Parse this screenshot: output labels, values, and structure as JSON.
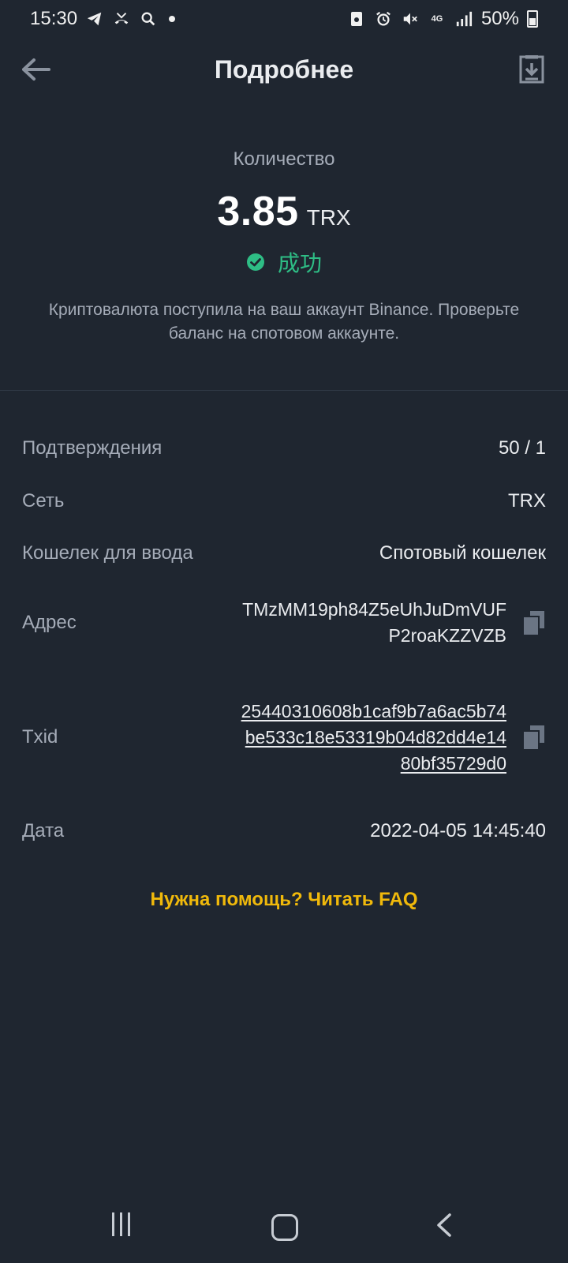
{
  "status_bar": {
    "time": "15:30",
    "battery": "50%",
    "network": "4G"
  },
  "header": {
    "title": "Подробнее"
  },
  "summary": {
    "quantity_label": "Количество",
    "amount": "3.85",
    "unit": "TRX",
    "status": "成功",
    "description": "Криптовалюта поступила на ваш аккаунт Binance. Проверьте баланс на спотовом аккаунте."
  },
  "details": {
    "confirmations": {
      "label": "Подтверждения",
      "value": "50 / 1"
    },
    "network": {
      "label": "Сеть",
      "value": "TRX"
    },
    "wallet": {
      "label": "Кошелек для ввода",
      "value": "Спотовый кошелек"
    },
    "address": {
      "label": "Адрес",
      "lines": [
        "TMzMM19ph84Z5eUhJuDmVUF",
        "P2roaKZZVZB"
      ]
    },
    "txid": {
      "label": "Txid",
      "lines": [
        "25440310608b1caf9b7a6ac5b74",
        "be533c18e53319b04d82dd4e14",
        "80bf35729d0"
      ]
    },
    "date": {
      "label": "Дата",
      "value": "2022-04-05 14:45:40"
    }
  },
  "help": {
    "faq_link": "Нужна помощь? Читать FAQ"
  },
  "colors": {
    "background": "#1f2630",
    "success": "#2ebd85",
    "accent": "#f0b90b",
    "muted": "#a5acb8"
  }
}
